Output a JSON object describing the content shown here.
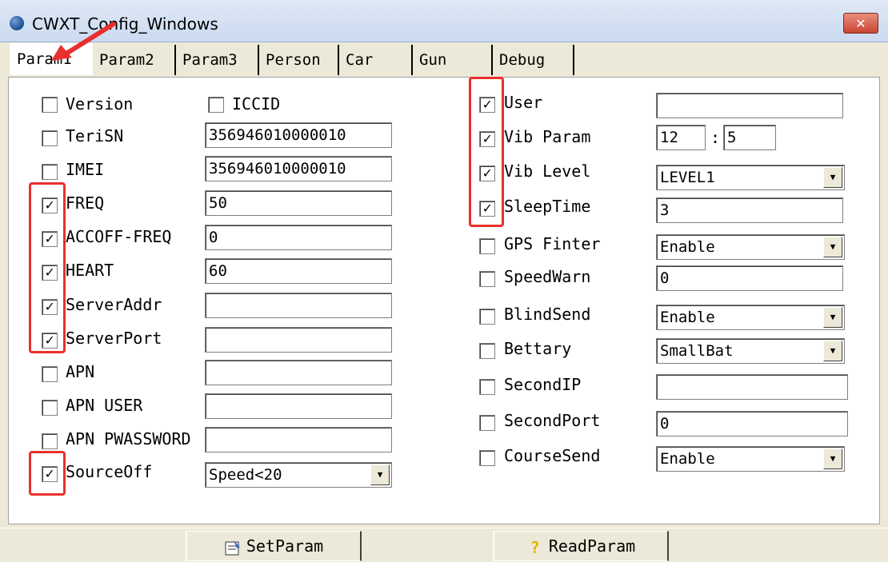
{
  "window": {
    "title": "CWXT_Config_Windows",
    "close_glyph": "✕"
  },
  "tabs": [
    {
      "label": "Param1"
    },
    {
      "label": "Param2"
    },
    {
      "label": "Param3"
    },
    {
      "label": "Person"
    },
    {
      "label": "Car"
    },
    {
      "label": "Gun"
    },
    {
      "label": "Debug"
    }
  ],
  "left_fields": [
    {
      "label": "Version",
      "checked": false
    },
    {
      "label": "TeriSN",
      "checked": false,
      "value": "356946010000010"
    },
    {
      "label": "IMEI",
      "checked": false,
      "value": "356946010000010"
    },
    {
      "label": "FREQ",
      "checked": true,
      "value": "50"
    },
    {
      "label": "ACCOFF-FREQ",
      "checked": true,
      "value": "0"
    },
    {
      "label": "HEART",
      "checked": true,
      "value": "60"
    },
    {
      "label": "ServerAddr",
      "checked": true,
      "value": ""
    },
    {
      "label": "ServerPort",
      "checked": true,
      "value": ""
    },
    {
      "label": "APN",
      "checked": false,
      "value": ""
    },
    {
      "label": "APN USER",
      "checked": false,
      "value": ""
    },
    {
      "label": "APN PWASSWORD",
      "checked": false,
      "value": ""
    },
    {
      "label": "SourceOff",
      "checked": true,
      "value": "Speed<20"
    }
  ],
  "iccid": {
    "label": "ICCID",
    "checked": false
  },
  "right_fields": [
    {
      "label": "User",
      "checked": true,
      "value": ""
    },
    {
      "label": "Vib Param",
      "checked": true,
      "value_a": "12",
      "sep": ":",
      "value_b": "5"
    },
    {
      "label": "Vib Level",
      "checked": true,
      "value": "LEVEL1"
    },
    {
      "label": "SleepTime",
      "checked": true,
      "value": "3"
    },
    {
      "label": "GPS Finter",
      "checked": false,
      "value": "Enable"
    },
    {
      "label": "SpeedWarn",
      "checked": false,
      "value": "0"
    },
    {
      "label": "BlindSend",
      "checked": false,
      "value": "Enable"
    },
    {
      "label": "Bettary",
      "checked": false,
      "value": "SmallBat"
    },
    {
      "label": "SecondIP",
      "checked": false,
      "value": ""
    },
    {
      "label": "SecondPort",
      "checked": false,
      "value": "0"
    },
    {
      "label": "CourseSend",
      "checked": false,
      "value": "Enable"
    }
  ],
  "buttons": {
    "set": "SetParam",
    "read": "ReadParam"
  },
  "colors": {
    "annotation": "#e8302e"
  }
}
